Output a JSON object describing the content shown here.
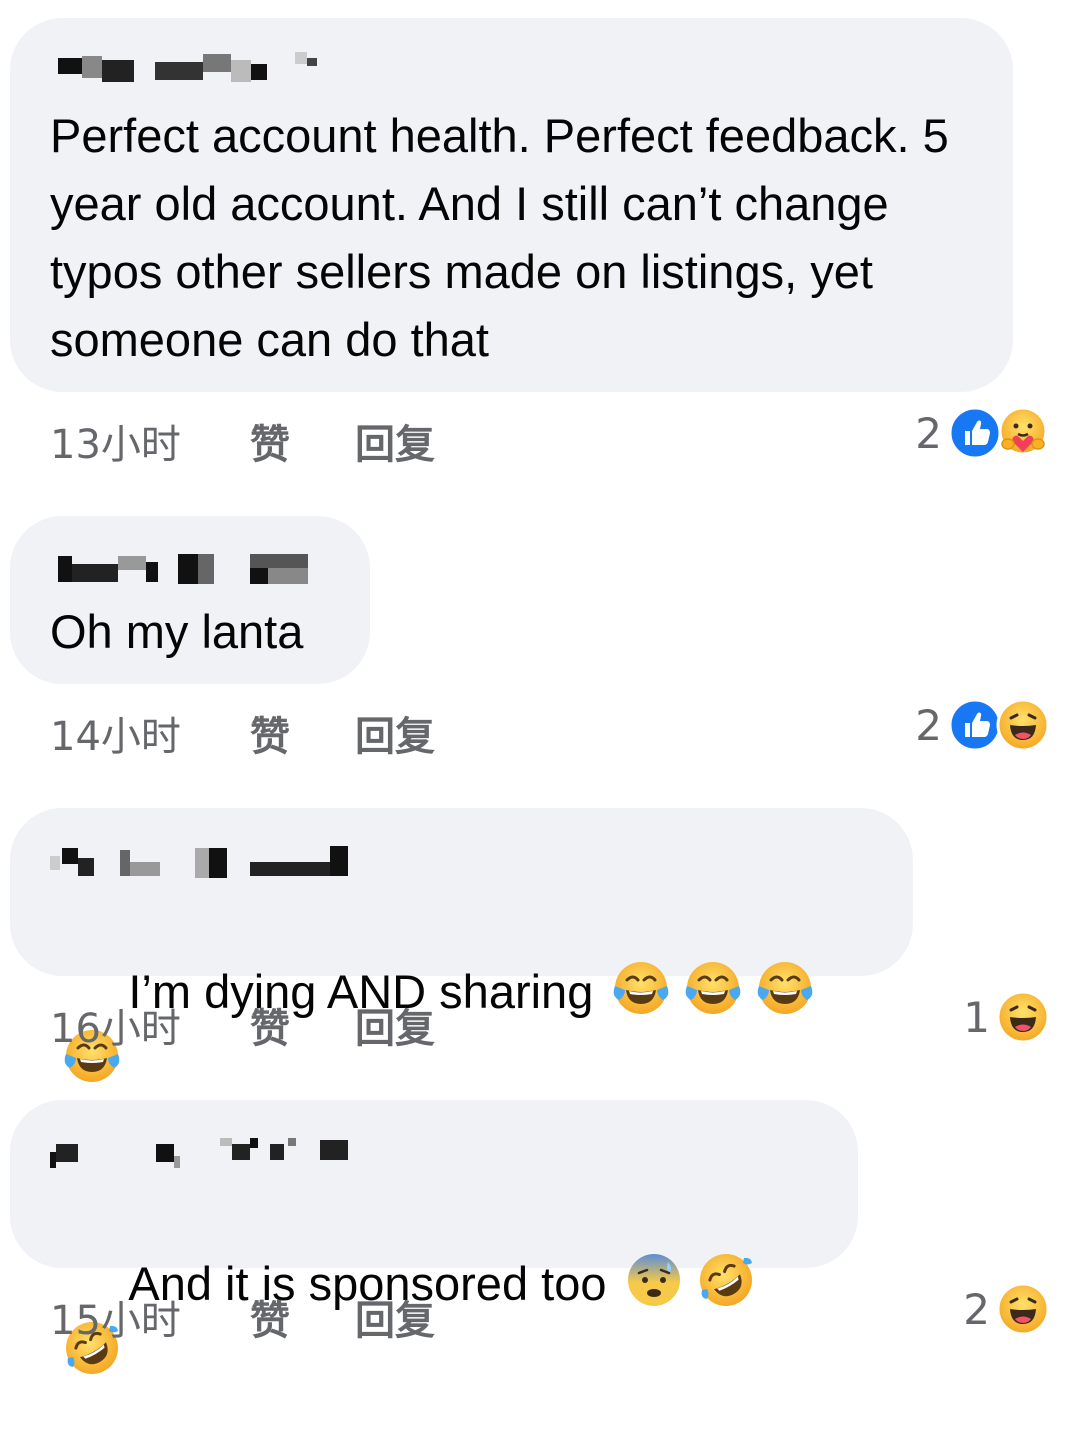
{
  "comments": [
    {
      "text": "Perfect account health. Perfect feedback. 5 year old account. And I still can’t change typos other sellers made on listings, yet someone can do that",
      "time": "13小时",
      "like_label": "赞",
      "reply_label": "回复",
      "reaction_count": "2",
      "reactions": [
        "like-icon",
        "care-icon"
      ]
    },
    {
      "text": "Oh my lanta",
      "time": "14小时",
      "like_label": "赞",
      "reply_label": "回复",
      "reaction_count": "2",
      "reactions": [
        "like-icon",
        "haha-icon"
      ]
    },
    {
      "text": "I’m dying AND sharing",
      "inline_emojis": [
        "tears-of-joy-icon",
        "tears-of-joy-icon",
        "tears-of-joy-icon",
        "tears-of-joy-icon"
      ],
      "time": "16小时",
      "like_label": "赞",
      "reply_label": "回复",
      "reaction_count": "1",
      "reactions": [
        "haha-icon"
      ]
    },
    {
      "text": "And it is sponsored too",
      "inline_emojis": [
        "anxious-sweat-icon",
        "rofl-icon",
        "rofl-icon"
      ],
      "time": "15小时",
      "like_label": "赞",
      "reply_label": "回复",
      "reaction_count": "2",
      "reactions": [
        "haha-icon"
      ]
    }
  ],
  "colors": {
    "bubble": "#f0f2f5",
    "text": "#050505",
    "meta": "#65676b",
    "like_blue": "#1877f2",
    "emoji_yellow": "#f7b125"
  }
}
